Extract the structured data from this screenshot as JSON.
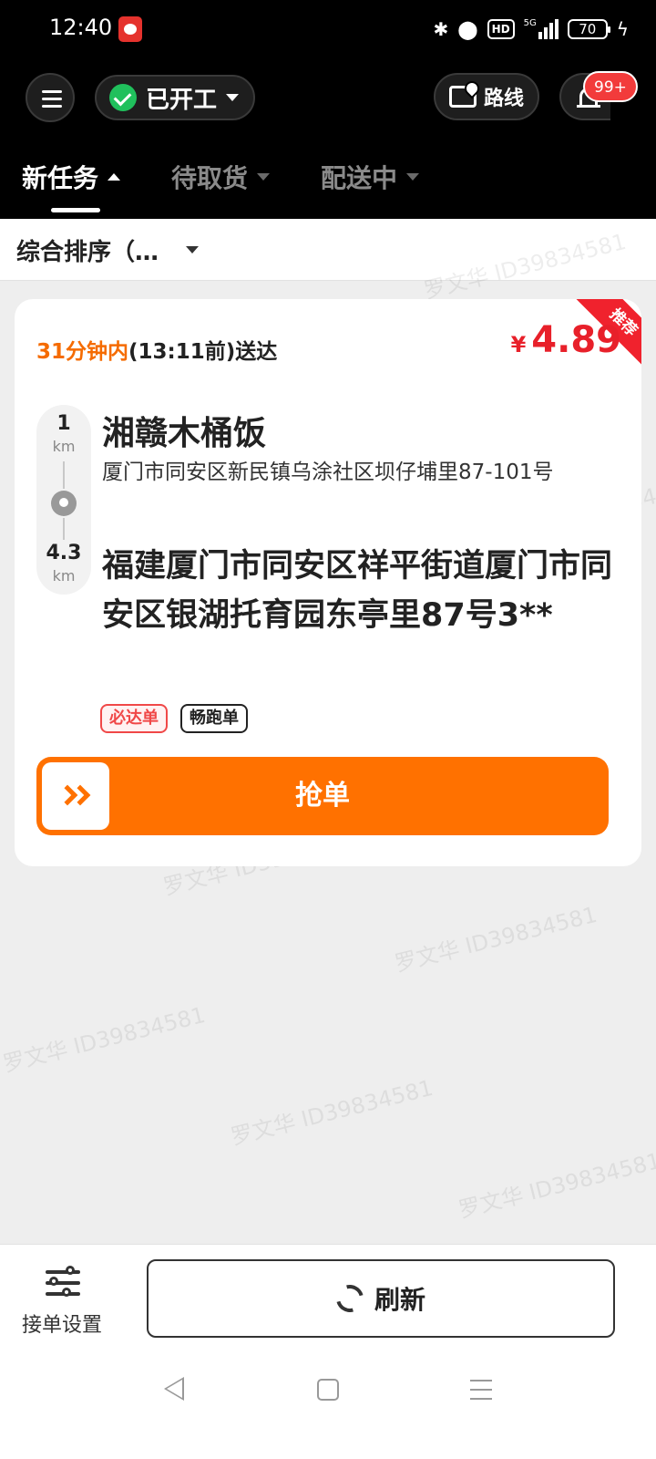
{
  "status_bar": {
    "time": "12:40",
    "bluetooth_icon": "bluetooth-icon",
    "location_icon": "location-icon",
    "hd_label": "HD",
    "network_label": "5G",
    "battery": "70"
  },
  "header": {
    "work_status": "已开工",
    "route_label": "路线",
    "notification_badge": "99+"
  },
  "tabs": [
    {
      "label": "新任务",
      "active": true
    },
    {
      "label": "待取货",
      "active": false
    },
    {
      "label": "配送中",
      "active": false
    }
  ],
  "sort": {
    "label": "综合排序（…"
  },
  "order": {
    "ribbon": "推荐",
    "deliver_highlight": "31分钟内",
    "deliver_rest": "(13:11前)送达",
    "currency": "¥",
    "price": "4.89",
    "pickup_distance": "1",
    "pickup_unit": "km",
    "drop_distance": "4.3",
    "drop_unit": "km",
    "shop_name": "湘赣木桶饭",
    "shop_address": "厦门市同安区新民镇乌涂社区坝仔埔里87-101号",
    "dest_address": "福建厦门市同安区祥平街道厦门市同安区银湖托育园东亭里87号3**",
    "tags": [
      "必达单",
      "畅跑单"
    ],
    "grab_label": "抢单"
  },
  "watermark": "罗文华 ID39834581",
  "bottom": {
    "settings_label": "接单设置",
    "refresh_label": "刷新"
  },
  "colors": {
    "accent_orange": "#ff7100",
    "price_red": "#e8202a",
    "status_green": "#20c05c"
  }
}
